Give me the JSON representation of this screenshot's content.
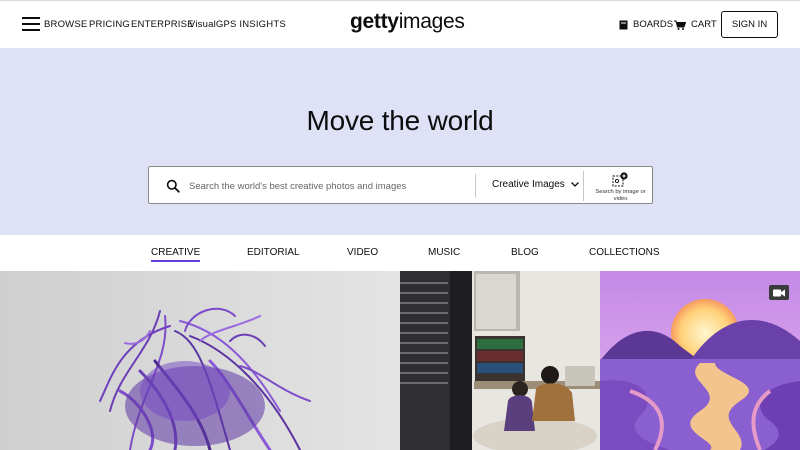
{
  "header": {
    "nav": [
      {
        "label": "BROWSE"
      },
      {
        "label": "PRICING"
      },
      {
        "label": "ENTERPRISE"
      },
      {
        "label": "VisualGPS INSIGHTS"
      }
    ],
    "logo_bold": "getty",
    "logo_light": "images",
    "boards_label": "BOARDS",
    "cart_label": "CART",
    "signin_label": "SIGN IN"
  },
  "hero": {
    "title": "Move the world",
    "search": {
      "placeholder": "Search the world's best creative photos and images",
      "type_selected": "Creative Images",
      "visual_search_label": "Search by image or video"
    },
    "background_color": "#dfe1f7"
  },
  "tabs": [
    {
      "label": "CREATIVE",
      "active": true
    },
    {
      "label": "EDITORIAL"
    },
    {
      "label": "VIDEO"
    },
    {
      "label": "MUSIC"
    },
    {
      "label": "BLOG"
    },
    {
      "label": "COLLECTIONS"
    }
  ],
  "accent_color": "#6440d8",
  "gallery": [
    {
      "name": "purple-fiber-sculpture",
      "type": "image"
    },
    {
      "name": "teacher-student-classroom",
      "type": "image"
    },
    {
      "name": "purple-sunset-river-landscape",
      "type": "video",
      "icon": "video-camera-icon"
    }
  ]
}
